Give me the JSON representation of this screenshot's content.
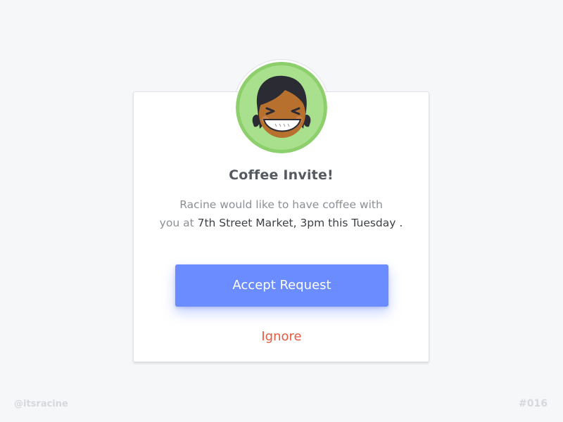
{
  "dialog": {
    "title": "Coffee Invite!",
    "message_line1": "Racine would like to have coffee with",
    "message_line2_prefix": "you at ",
    "message_highlight": "7th Street Market, 3pm this Tuesday",
    "message_line2_suffix": " .",
    "accept_label": "Accept Request",
    "ignore_label": "Ignore"
  },
  "footer": {
    "handle": "@itsracine",
    "shot_number": "#016"
  },
  "colors": {
    "page_background": "#f6f7f9",
    "accent": "#6b8cfe",
    "ignore": "#e55c40",
    "avatar_ring": "#8dcf6c"
  },
  "icons": {
    "avatar": "smiling-girl-avatar-icon"
  }
}
